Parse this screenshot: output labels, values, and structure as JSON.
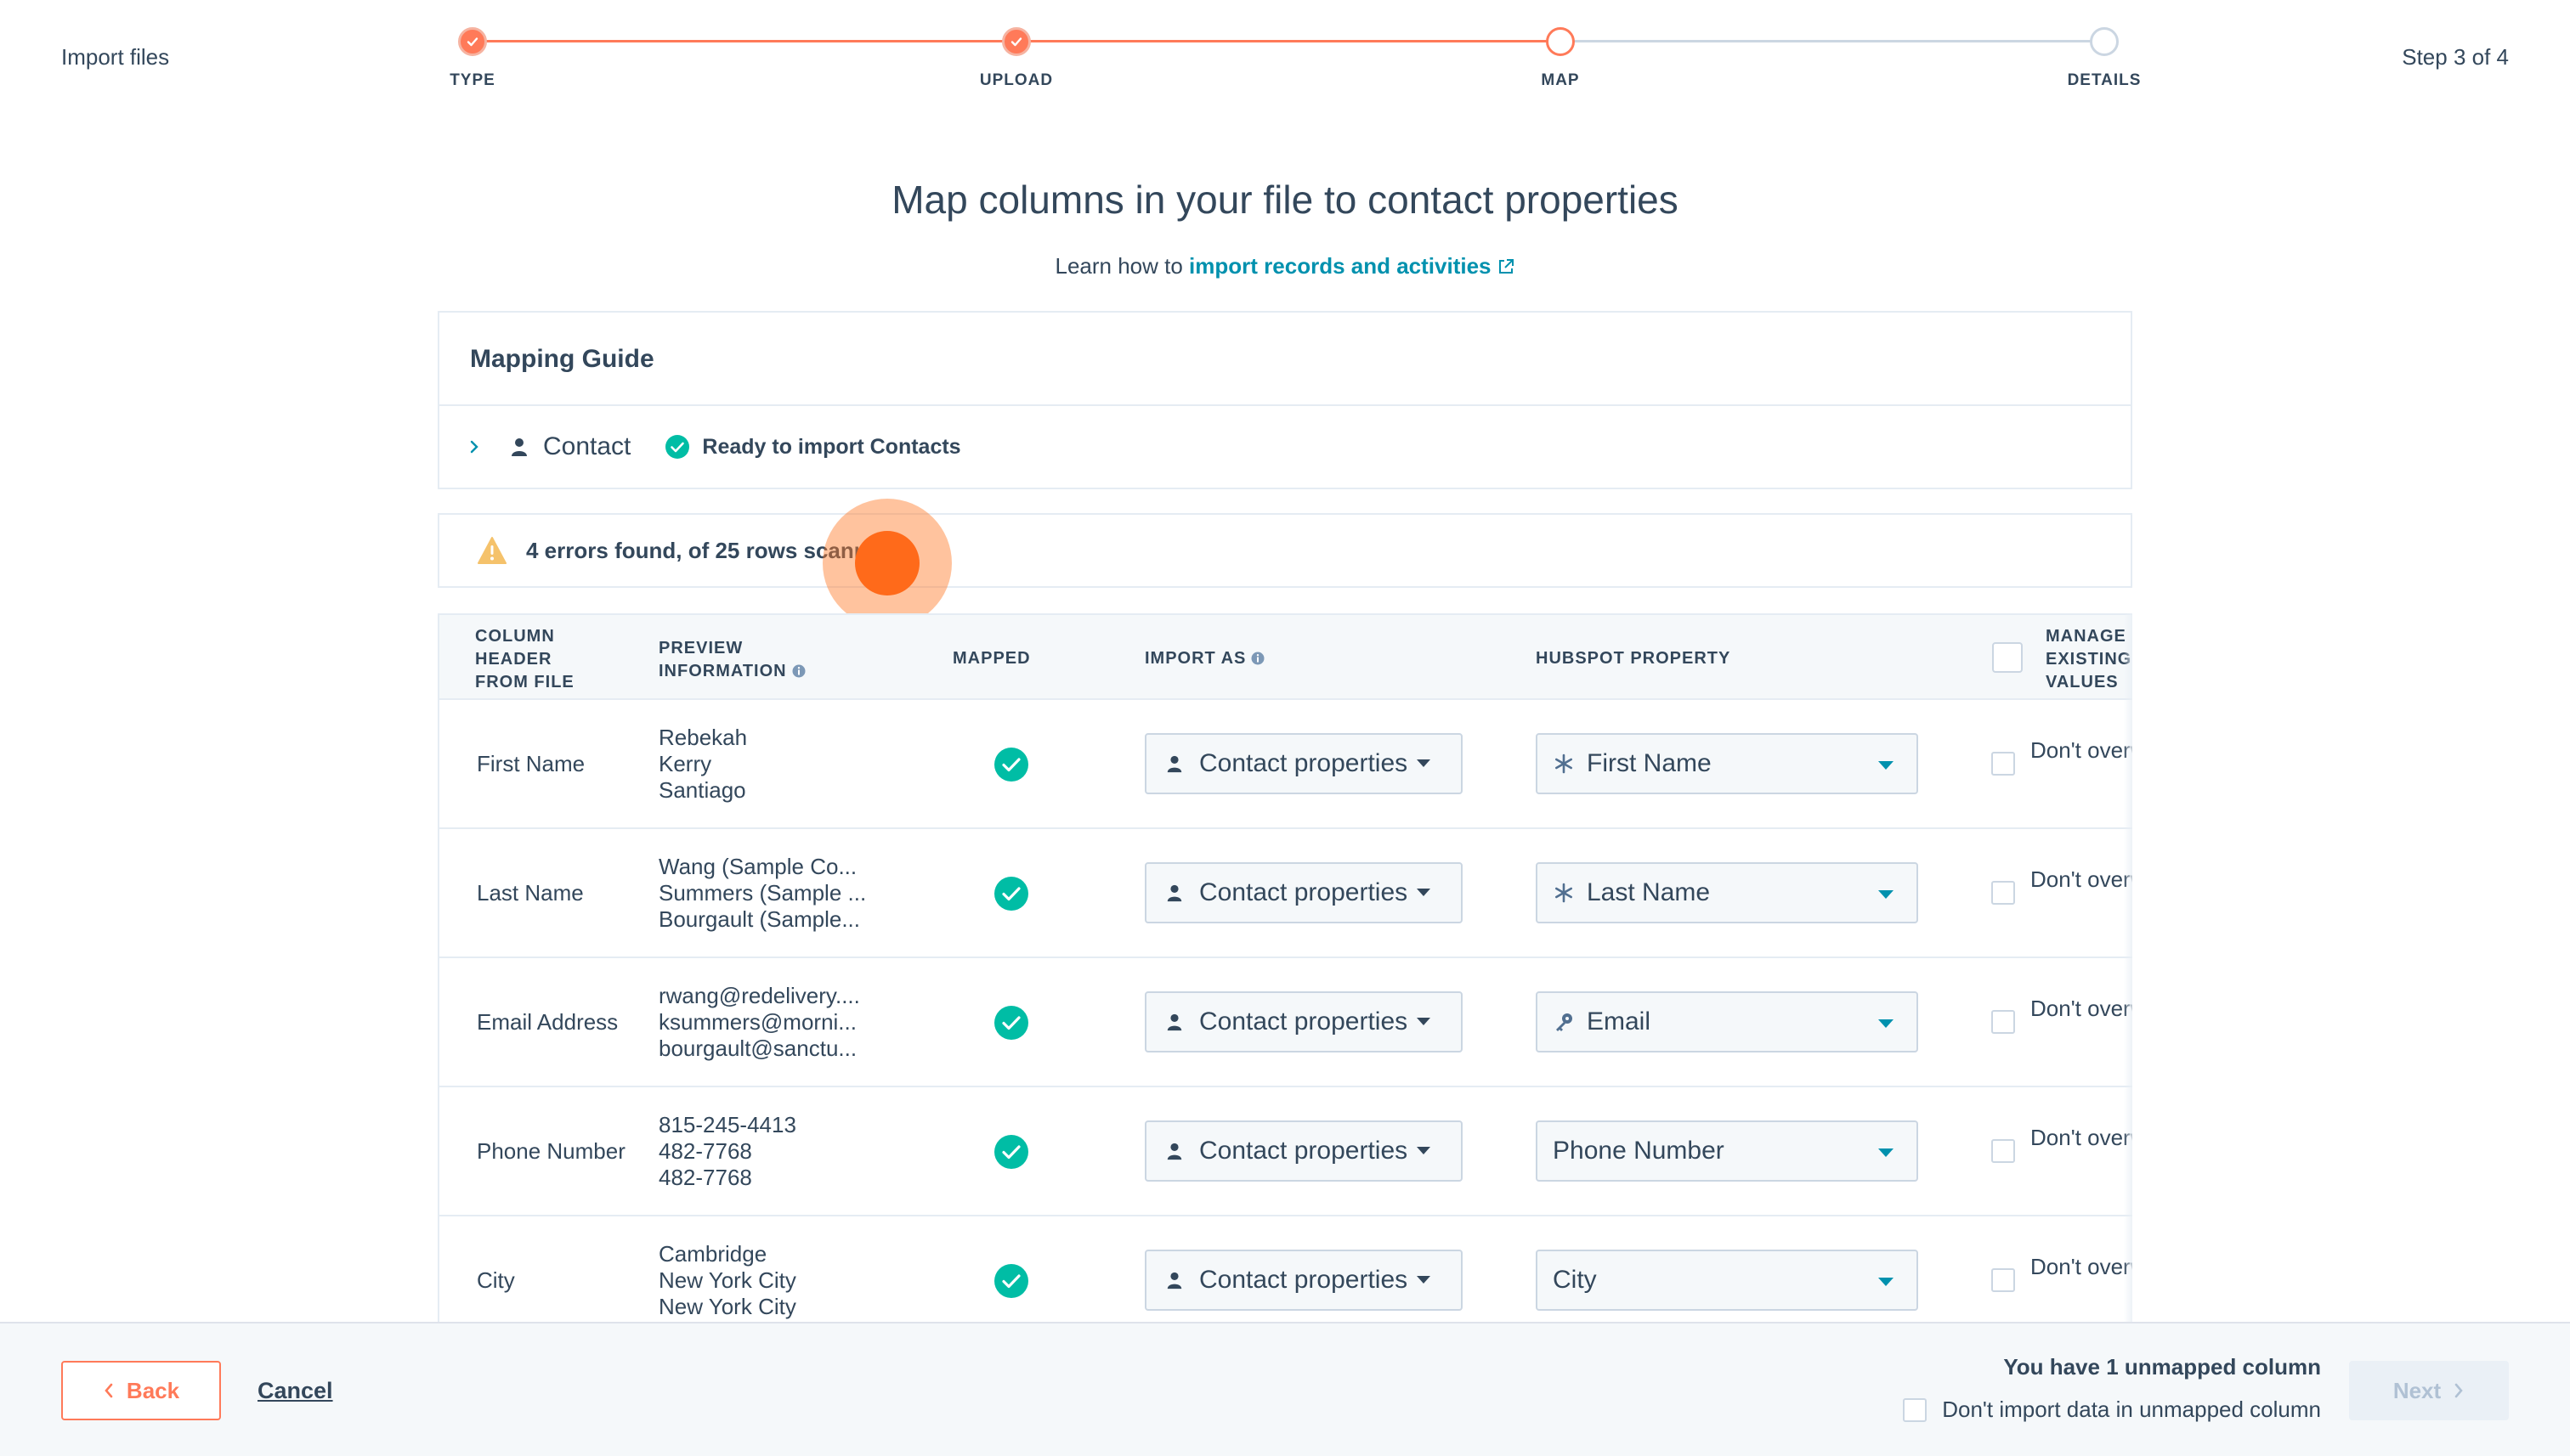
{
  "header": {
    "title": "Import files",
    "step_indicator": "Step 3 of 4",
    "steps": [
      {
        "label": "TYPE",
        "state": "done"
      },
      {
        "label": "UPLOAD",
        "state": "done"
      },
      {
        "label": "MAP",
        "state": "current"
      },
      {
        "label": "DETAILS",
        "state": "todo"
      }
    ]
  },
  "main": {
    "heading": "Map columns in your file to contact properties",
    "learn_prefix": "Learn how to",
    "learn_link": "import records and activities"
  },
  "mapping_guide": {
    "title": "Mapping Guide",
    "object_label": "Contact",
    "status": "Ready to import Contacts"
  },
  "errors": {
    "text": "4 errors found, of 25 rows scanned"
  },
  "table": {
    "headers": {
      "column": "COLUMN\nHEADER\nFROM FILE",
      "preview": "PREVIEW\nINFORMATION",
      "mapped": "MAPPED",
      "import_as": "IMPORT AS",
      "property": "HUBSPOT PROPERTY",
      "manage": "MANAGE\nEXISTING\nVALUES"
    },
    "rows": [
      {
        "column": "First Name",
        "preview": [
          "Rebekah",
          "Kerry",
          "Santiago"
        ],
        "import_as": "Contact properties",
        "property": "First Name",
        "property_icon": "asterisk-icon",
        "overwrite": "Don't overwrite"
      },
      {
        "column": "Last Name",
        "preview": [
          "Wang (Sample Co...",
          "Summers (Sample ...",
          "Bourgault (Sample..."
        ],
        "import_as": "Contact properties",
        "property": "Last Name",
        "property_icon": "asterisk-icon",
        "overwrite": "Don't overwrite"
      },
      {
        "column": "Email Address",
        "preview": [
          "rwang@redelivery....",
          "ksummers@morni...",
          "bourgault@sanctu..."
        ],
        "import_as": "Contact properties",
        "property": "Email",
        "property_icon": "key-icon",
        "overwrite": "Don't overwrite"
      },
      {
        "column": "Phone Number",
        "preview": [
          "815-245-4413",
          "482-7768",
          "482-7768"
        ],
        "import_as": "Contact properties",
        "property": "Phone Number",
        "property_icon": "",
        "overwrite": "Don't overwrite"
      },
      {
        "column": "City",
        "preview": [
          "Cambridge",
          "New York City",
          "New York City"
        ],
        "import_as": "Contact properties",
        "property": "City",
        "property_icon": "",
        "overwrite": "Don't overwrite"
      }
    ]
  },
  "footer": {
    "back_label": "Back",
    "cancel_label": "Cancel",
    "unmapped_text": "You have 1 unmapped column",
    "dont_import_label": "Don't import data in unmapped column",
    "next_label": "Next"
  },
  "colors": {
    "accent": "#ff7a59",
    "link": "#0091ae",
    "success": "#00bda5",
    "text": "#33475b",
    "warning": "#f5c26b"
  }
}
